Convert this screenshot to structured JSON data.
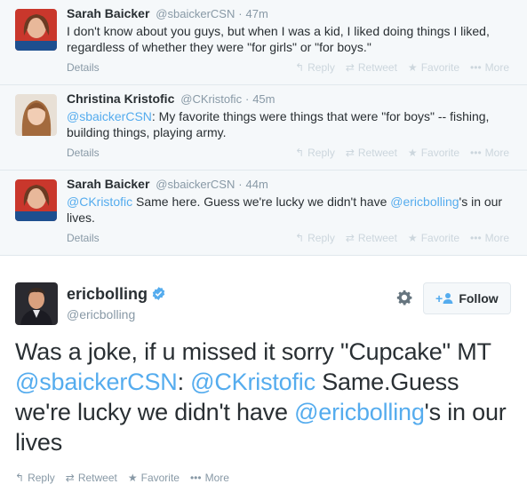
{
  "replies": [
    {
      "fullname": "Sarah Baicker",
      "username": "@sbaickerCSN",
      "sep": "·",
      "time": "47m",
      "text_plain": "I don't know about you guys, but when I was a kid, I liked doing things I liked, regardless of whether they were \"for girls\" or \"for boys.\"",
      "details": "Details",
      "avatar_badge": "CSN"
    },
    {
      "fullname": "Christina Kristofic",
      "username": "@CKristofic",
      "sep": "·",
      "time": "45m",
      "mention": "@sbaickerCSN",
      "text_rest": ": My favorite things were things that were \"for boys\" -- fishing, building things, playing army.",
      "details": "Details"
    },
    {
      "fullname": "Sarah Baicker",
      "username": "@sbaickerCSN",
      "sep": "·",
      "time": "44m",
      "mention": "@CKristofic",
      "text_mid": " Same here. Guess we're lucky we didn't have ",
      "mention2": "@ericbolling",
      "text_end": "'s in our lives.",
      "details": "Details",
      "avatar_badge": "CSN"
    }
  ],
  "small_actions": {
    "reply": "Reply",
    "retweet": "Retweet",
    "favorite": "Favorite",
    "more": "More"
  },
  "main_tweet": {
    "fullname": "ericbolling",
    "username": "@ericbolling",
    "follow_label": "Follow",
    "text_1": "Was a joke, if u missed it sorry \"Cupcake\" MT ",
    "mention_1": "@sbaickerCSN",
    "text_2": ": ",
    "mention_2": "@CKristofic",
    "text_3": " Same.Guess we're lucky we didn't have ",
    "mention_3": "@ericbolling",
    "text_4": "'s in our lives",
    "actions": {
      "reply": "Reply",
      "retweet": "Retweet",
      "favorite": "Favorite",
      "more": "More"
    }
  },
  "icons": {
    "reply": "reply-arrow-icon",
    "retweet": "retweet-icon",
    "favorite": "star-icon",
    "more": "ellipsis-icon",
    "settings": "gear-icon",
    "verified": "verified-badge-icon",
    "follow": "add-user-icon"
  },
  "colors": {
    "link": "#55acee",
    "text": "#292f33",
    "muted": "#8899a6",
    "faint": "#ccd6dd",
    "reply_bg": "#f5f8fa"
  }
}
